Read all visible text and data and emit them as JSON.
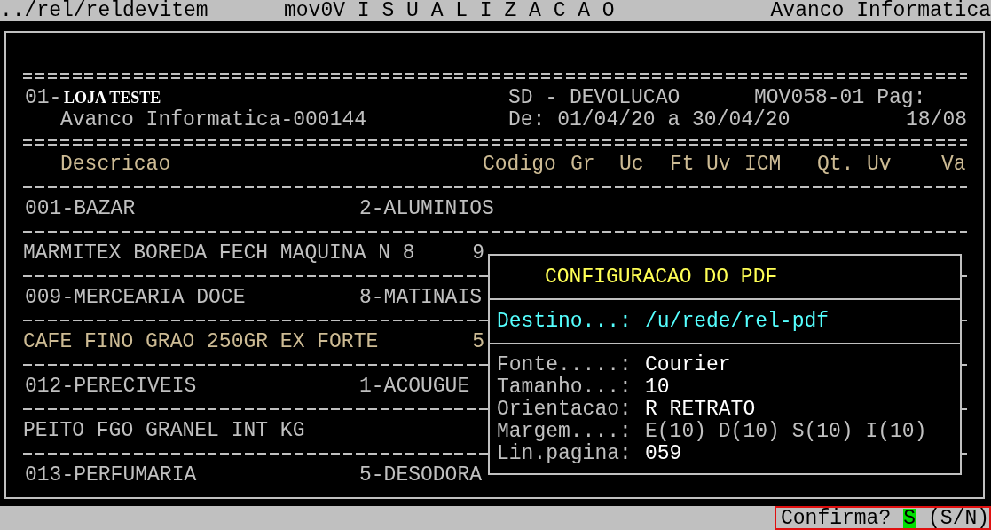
{
  "top_bar": {
    "path": "../rel/reldevitem",
    "program": "mov0V I S U A L I Z A C A O",
    "company": "Avanco Informatica"
  },
  "report_header": {
    "store_code": "01-",
    "store_name": "LOJA TESTE",
    "report_type": "SD - DEVOLUCAO",
    "report_code": "MOV058-01",
    "page_label": "Pag:",
    "company": "Avanco Informatica-000144",
    "period": "De: 01/04/20 a 30/04/20",
    "page_number": "18/08"
  },
  "columns": [
    "Descricao",
    "Codigo",
    "Gr",
    "Uc",
    "Ft",
    "Uv",
    "ICM",
    "Qt.",
    "Uv",
    "Va"
  ],
  "rows": [
    {
      "kind": "group",
      "code": "001-BAZAR",
      "subgroup": "2-ALUMINIOS",
      "highlighted": false
    },
    {
      "kind": "item",
      "description": "MARMITEX BOREDA FECH MAQUINA N 8",
      "code": "9",
      "highlighted": false
    },
    {
      "kind": "group",
      "code": "009-MERCEARIA DOCE",
      "subgroup": "8-MATINAIS",
      "highlighted": false
    },
    {
      "kind": "item",
      "description": "CAFE FINO GRAO 250GR EX FORTE",
      "code": "5",
      "highlighted": true
    },
    {
      "kind": "group",
      "code": "012-PERECIVEIS",
      "subgroup": "1-ACOUGUE",
      "highlighted": false
    },
    {
      "kind": "item",
      "description": "PEITO FGO GRANEL INT KG",
      "code": "",
      "highlighted": false
    },
    {
      "kind": "group",
      "code": "013-PERFUMARIA",
      "subgroup": "5-DESODORA",
      "highlighted": false
    }
  ],
  "dialog": {
    "title": "CONFIGURACAO DO PDF",
    "destination_label": "Destino...:",
    "destination": "/u/rede/rel-pdf",
    "fields": [
      {
        "label": "Fonte.....:",
        "value": "Courier",
        "dimmed": false
      },
      {
        "label": "Tamanho...:",
        "value": "10",
        "dimmed": false
      },
      {
        "label": "Orientacao:",
        "value": "R RETRATO",
        "dimmed": false
      },
      {
        "label": "Margem....:",
        "value": "E(10) D(10) S(10) I(10)",
        "dimmed": true
      },
      {
        "label": "Lin.pagina:",
        "value": "059",
        "dimmed": false
      }
    ]
  },
  "prompt": {
    "label": "Confirma?",
    "value": "S",
    "options": "(S/N)"
  }
}
